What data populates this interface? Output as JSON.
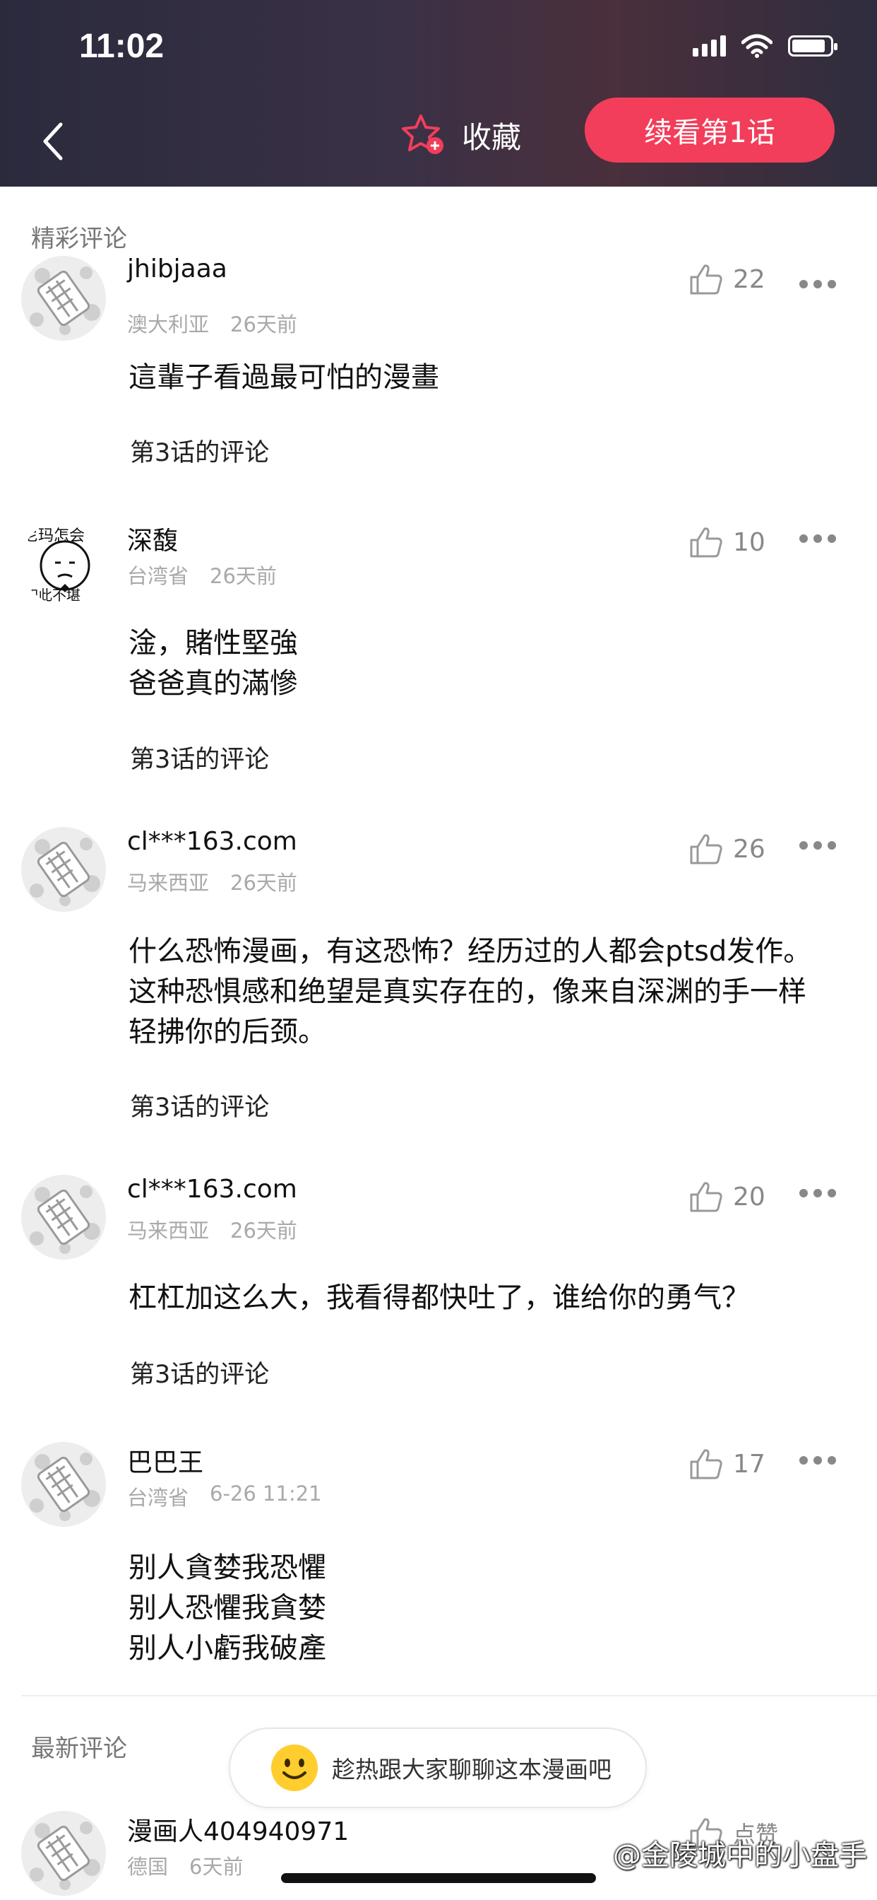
{
  "status_bar": {
    "time": "11:02"
  },
  "header": {
    "favorite_label": "收藏",
    "continue_label": "续看第1话",
    "accent_color": "#f23e5a"
  },
  "sections": {
    "featured_title": "精彩评论",
    "latest_title": "最新评论"
  },
  "comments": [
    {
      "username": "jhibjaaa",
      "location": "澳大利亚",
      "time": "26天前",
      "likes": "22",
      "lines": [
        "這輩子看過最可怕的漫畫"
      ],
      "chapter": "第3话的评论"
    },
    {
      "username": "深馥",
      "location": "台湾省",
      "time": "26天前",
      "likes": "10",
      "lines": [
        "淦，賭性堅強",
        "爸爸真的滿慘"
      ],
      "chapter": "第3话的评论",
      "avatar_text_top": "尼玛怎会",
      "avatar_text_bottom": "如此不堪"
    },
    {
      "username": "cl***163.com",
      "location": "马来西亚",
      "time": "26天前",
      "likes": "26",
      "lines": [
        "什么恐怖漫画，有这恐怖？经历过的人都会ptsd发作。",
        "这种恐惧感和绝望是真实存在的，像来自深渊的手一样",
        "轻拂你的后颈。"
      ],
      "chapter": "第3话的评论"
    },
    {
      "username": "cl***163.com",
      "location": "马来西亚",
      "time": "26天前",
      "likes": "20",
      "lines": [
        "杠杠加这么大，我看得都快吐了，谁给你的勇气？"
      ],
      "chapter": "第3话的评论"
    },
    {
      "username": "巴巴王",
      "location": "台湾省",
      "time": "6-26 11:21",
      "likes": "17",
      "lines": [
        "别人貪婪我恐懼",
        "别人恐懼我貪婪",
        "别人小虧我破產"
      ]
    }
  ],
  "latest_comment": {
    "username": "漫画人404940971",
    "location": "德国",
    "time": "6天前",
    "likes": "点赞"
  },
  "prompt": {
    "text": "趁热跟大家聊聊这本漫画吧"
  },
  "watermark": "@金陵城中的小盘手"
}
